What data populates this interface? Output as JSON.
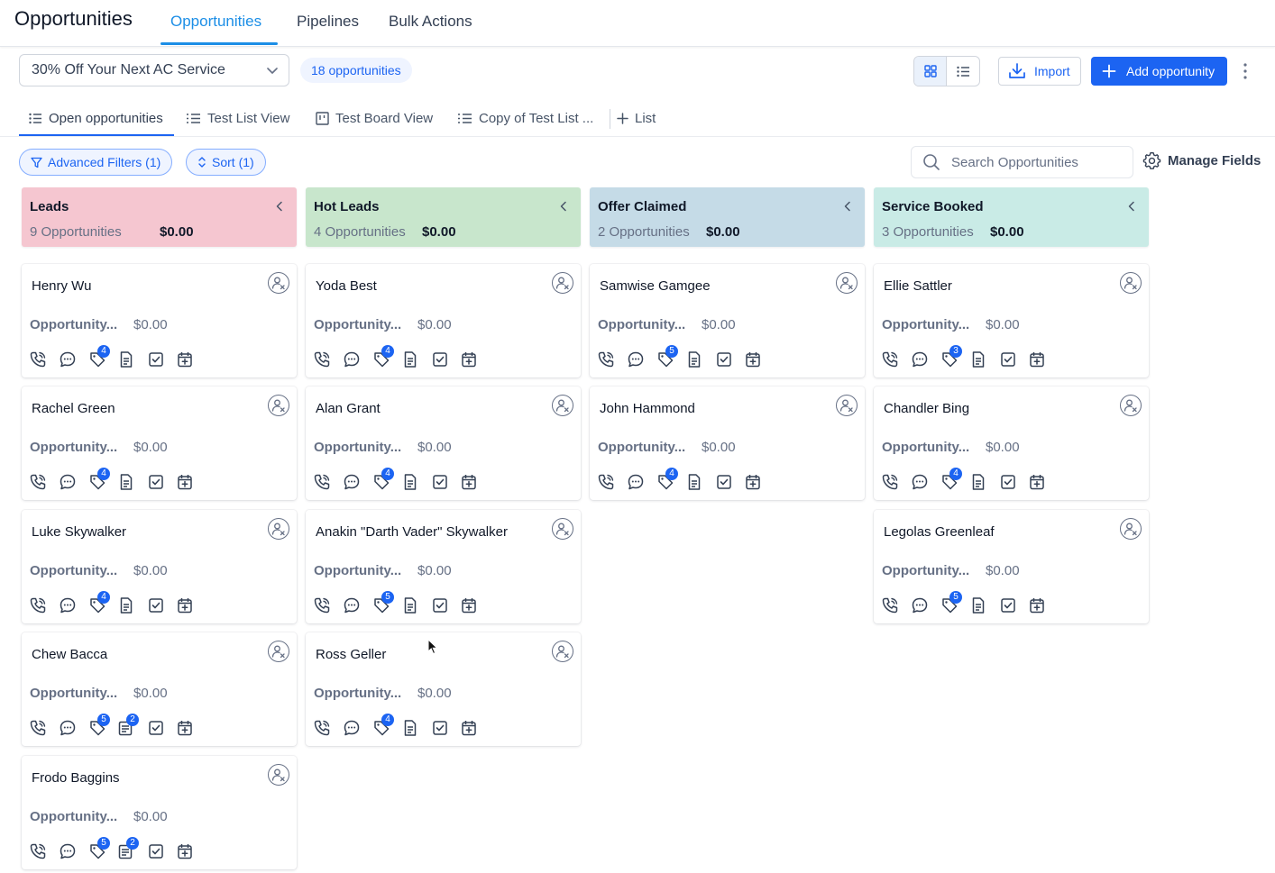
{
  "header": {
    "title": "Opportunities",
    "tabs": [
      {
        "label": "Opportunities",
        "active": true
      },
      {
        "label": "Pipelines",
        "active": false
      },
      {
        "label": "Bulk Actions",
        "active": false
      }
    ]
  },
  "toolbar": {
    "pipeline": "30% Off Your Next AC Service",
    "count_badge": "18 opportunities",
    "view_mode": "board",
    "import_label": "Import",
    "add_label": "Add opportunity"
  },
  "views": [
    {
      "label": "Open opportunities",
      "icon": "list-icon",
      "active": true
    },
    {
      "label": "Test List View",
      "icon": "list-icon",
      "active": false
    },
    {
      "label": "Test Board View",
      "icon": "board-icon",
      "active": false
    },
    {
      "label": "Copy of Test List ...",
      "icon": "list-icon",
      "active": false
    },
    {
      "label": "List",
      "icon": "plus-icon",
      "active": false
    }
  ],
  "filters": {
    "advanced_label": "Advanced Filters (1)",
    "sort_label": "Sort (1)",
    "search_placeholder": "Search Opportunities",
    "manage_fields_label": "Manage Fields"
  },
  "colors": {
    "accent": "#1c64f2",
    "leads": "#f5c6d0",
    "hot_leads": "#c8e6cc",
    "offer_claimed": "#c5dbe7",
    "service_booked": "#c9ebe6"
  },
  "columns": [
    {
      "title": "Leads",
      "count": "9 Opportunities",
      "sum": "$0.00",
      "color": "#f5c6d0",
      "cards": [
        {
          "name": "Henry Wu",
          "label": "Opportunity...",
          "value": "$0.00",
          "tasks_badge": "4",
          "notes_badge": ""
        },
        {
          "name": "Rachel Green",
          "label": "Opportunity...",
          "value": "$0.00",
          "tasks_badge": "4",
          "notes_badge": ""
        },
        {
          "name": "Luke Skywalker",
          "label": "Opportunity...",
          "value": "$0.00",
          "tasks_badge": "4",
          "notes_badge": ""
        },
        {
          "name": "Chew Bacca",
          "label": "Opportunity...",
          "value": "$0.00",
          "tasks_badge": "5",
          "notes_badge": "2"
        },
        {
          "name": "Frodo Baggins",
          "label": "Opportunity...",
          "value": "$0.00",
          "tasks_badge": "5",
          "notes_badge": "2"
        }
      ]
    },
    {
      "title": "Hot Leads",
      "count": "4 Opportunities",
      "sum": "$0.00",
      "color": "#c8e6cc",
      "cards": [
        {
          "name": "Yoda Best",
          "label": "Opportunity...",
          "value": "$0.00",
          "tasks_badge": "4",
          "notes_badge": ""
        },
        {
          "name": "Alan Grant",
          "label": "Opportunity...",
          "value": "$0.00",
          "tasks_badge": "4",
          "notes_badge": ""
        },
        {
          "name": "Anakin \"Darth Vader\" Skywalker",
          "label": "Opportunity...",
          "value": "$0.00",
          "tasks_badge": "5",
          "notes_badge": ""
        },
        {
          "name": "Ross Geller",
          "label": "Opportunity...",
          "value": "$0.00",
          "tasks_badge": "4",
          "notes_badge": ""
        }
      ]
    },
    {
      "title": "Offer Claimed",
      "count": "2 Opportunities",
      "sum": "$0.00",
      "color": "#c5dbe7",
      "cards": [
        {
          "name": "Samwise Gamgee",
          "label": "Opportunity...",
          "value": "$0.00",
          "tasks_badge": "5",
          "notes_badge": ""
        },
        {
          "name": "John Hammond",
          "label": "Opportunity...",
          "value": "$0.00",
          "tasks_badge": "4",
          "notes_badge": ""
        }
      ]
    },
    {
      "title": "Service Booked",
      "count": "3 Opportunities",
      "sum": "$0.00",
      "color": "#c9ebe6",
      "cards": [
        {
          "name": "Ellie Sattler",
          "label": "Opportunity...",
          "value": "$0.00",
          "tasks_badge": "3",
          "notes_badge": ""
        },
        {
          "name": "Chandler Bing",
          "label": "Opportunity...",
          "value": "$0.00",
          "tasks_badge": "4",
          "notes_badge": ""
        },
        {
          "name": "Legolas Greenleaf",
          "label": "Opportunity...",
          "value": "$0.00",
          "tasks_badge": "5",
          "notes_badge": ""
        }
      ]
    }
  ]
}
